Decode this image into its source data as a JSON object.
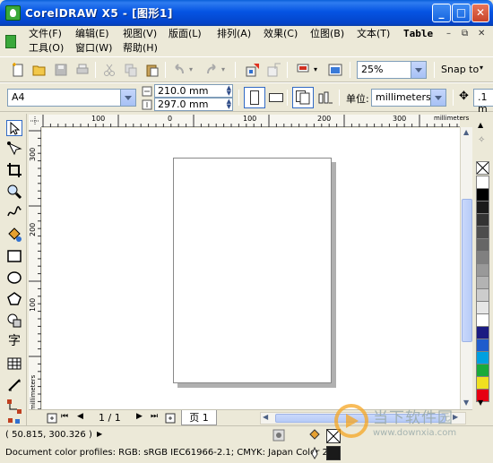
{
  "window": {
    "title": "CorelDRAW X5 - [图形1]"
  },
  "menu": {
    "row1": [
      "文件(F)",
      "编辑(E)",
      "视图(V)",
      "版面(L)",
      "排列(A)",
      "效果(C)",
      "位图(B)",
      "文本(T)",
      "Table"
    ],
    "row2": [
      "工具(O)",
      "窗口(W)",
      "帮助(H)"
    ]
  },
  "standard_toolbar": {
    "zoom": "25%",
    "snap": "Snap to"
  },
  "property_bar": {
    "page_size": "A4",
    "width": "210.0 mm",
    "height": "297.0 mm",
    "units_label": "单位:",
    "units": "millimeters",
    "nudge": ".1 m"
  },
  "ruler": {
    "top_labels": [
      "100",
      "0",
      "100",
      "200",
      "300"
    ],
    "left_labels": [
      "300",
      "200",
      "100"
    ],
    "unit": "millimeters"
  },
  "page_nav": {
    "count": "1 / 1",
    "tab": "页 1"
  },
  "status": {
    "coords": "( 50.815, 300.326 )",
    "profiles": "Document color profiles: RGB: sRGB IEC61966-2.1; CMYK: Japan Color 2..."
  },
  "watermark": {
    "line1": "当下软件园",
    "line2": "www.downxia.com"
  },
  "colors": {
    "title_blue": "#0554e3",
    "selection_blue": "#316ac5",
    "palette": [
      "#ffffff",
      "#000000",
      "#1a1a1a",
      "#333333",
      "#4d4d4d",
      "#666666",
      "#808080",
      "#999999",
      "#b3b3b3",
      "#cccccc",
      "#e6e6e6",
      "#ffffff",
      "#1b1b82",
      "#1f5ccc",
      "#00a0e0",
      "#1aaa3a",
      "#f0e020",
      "#e60012"
    ]
  }
}
